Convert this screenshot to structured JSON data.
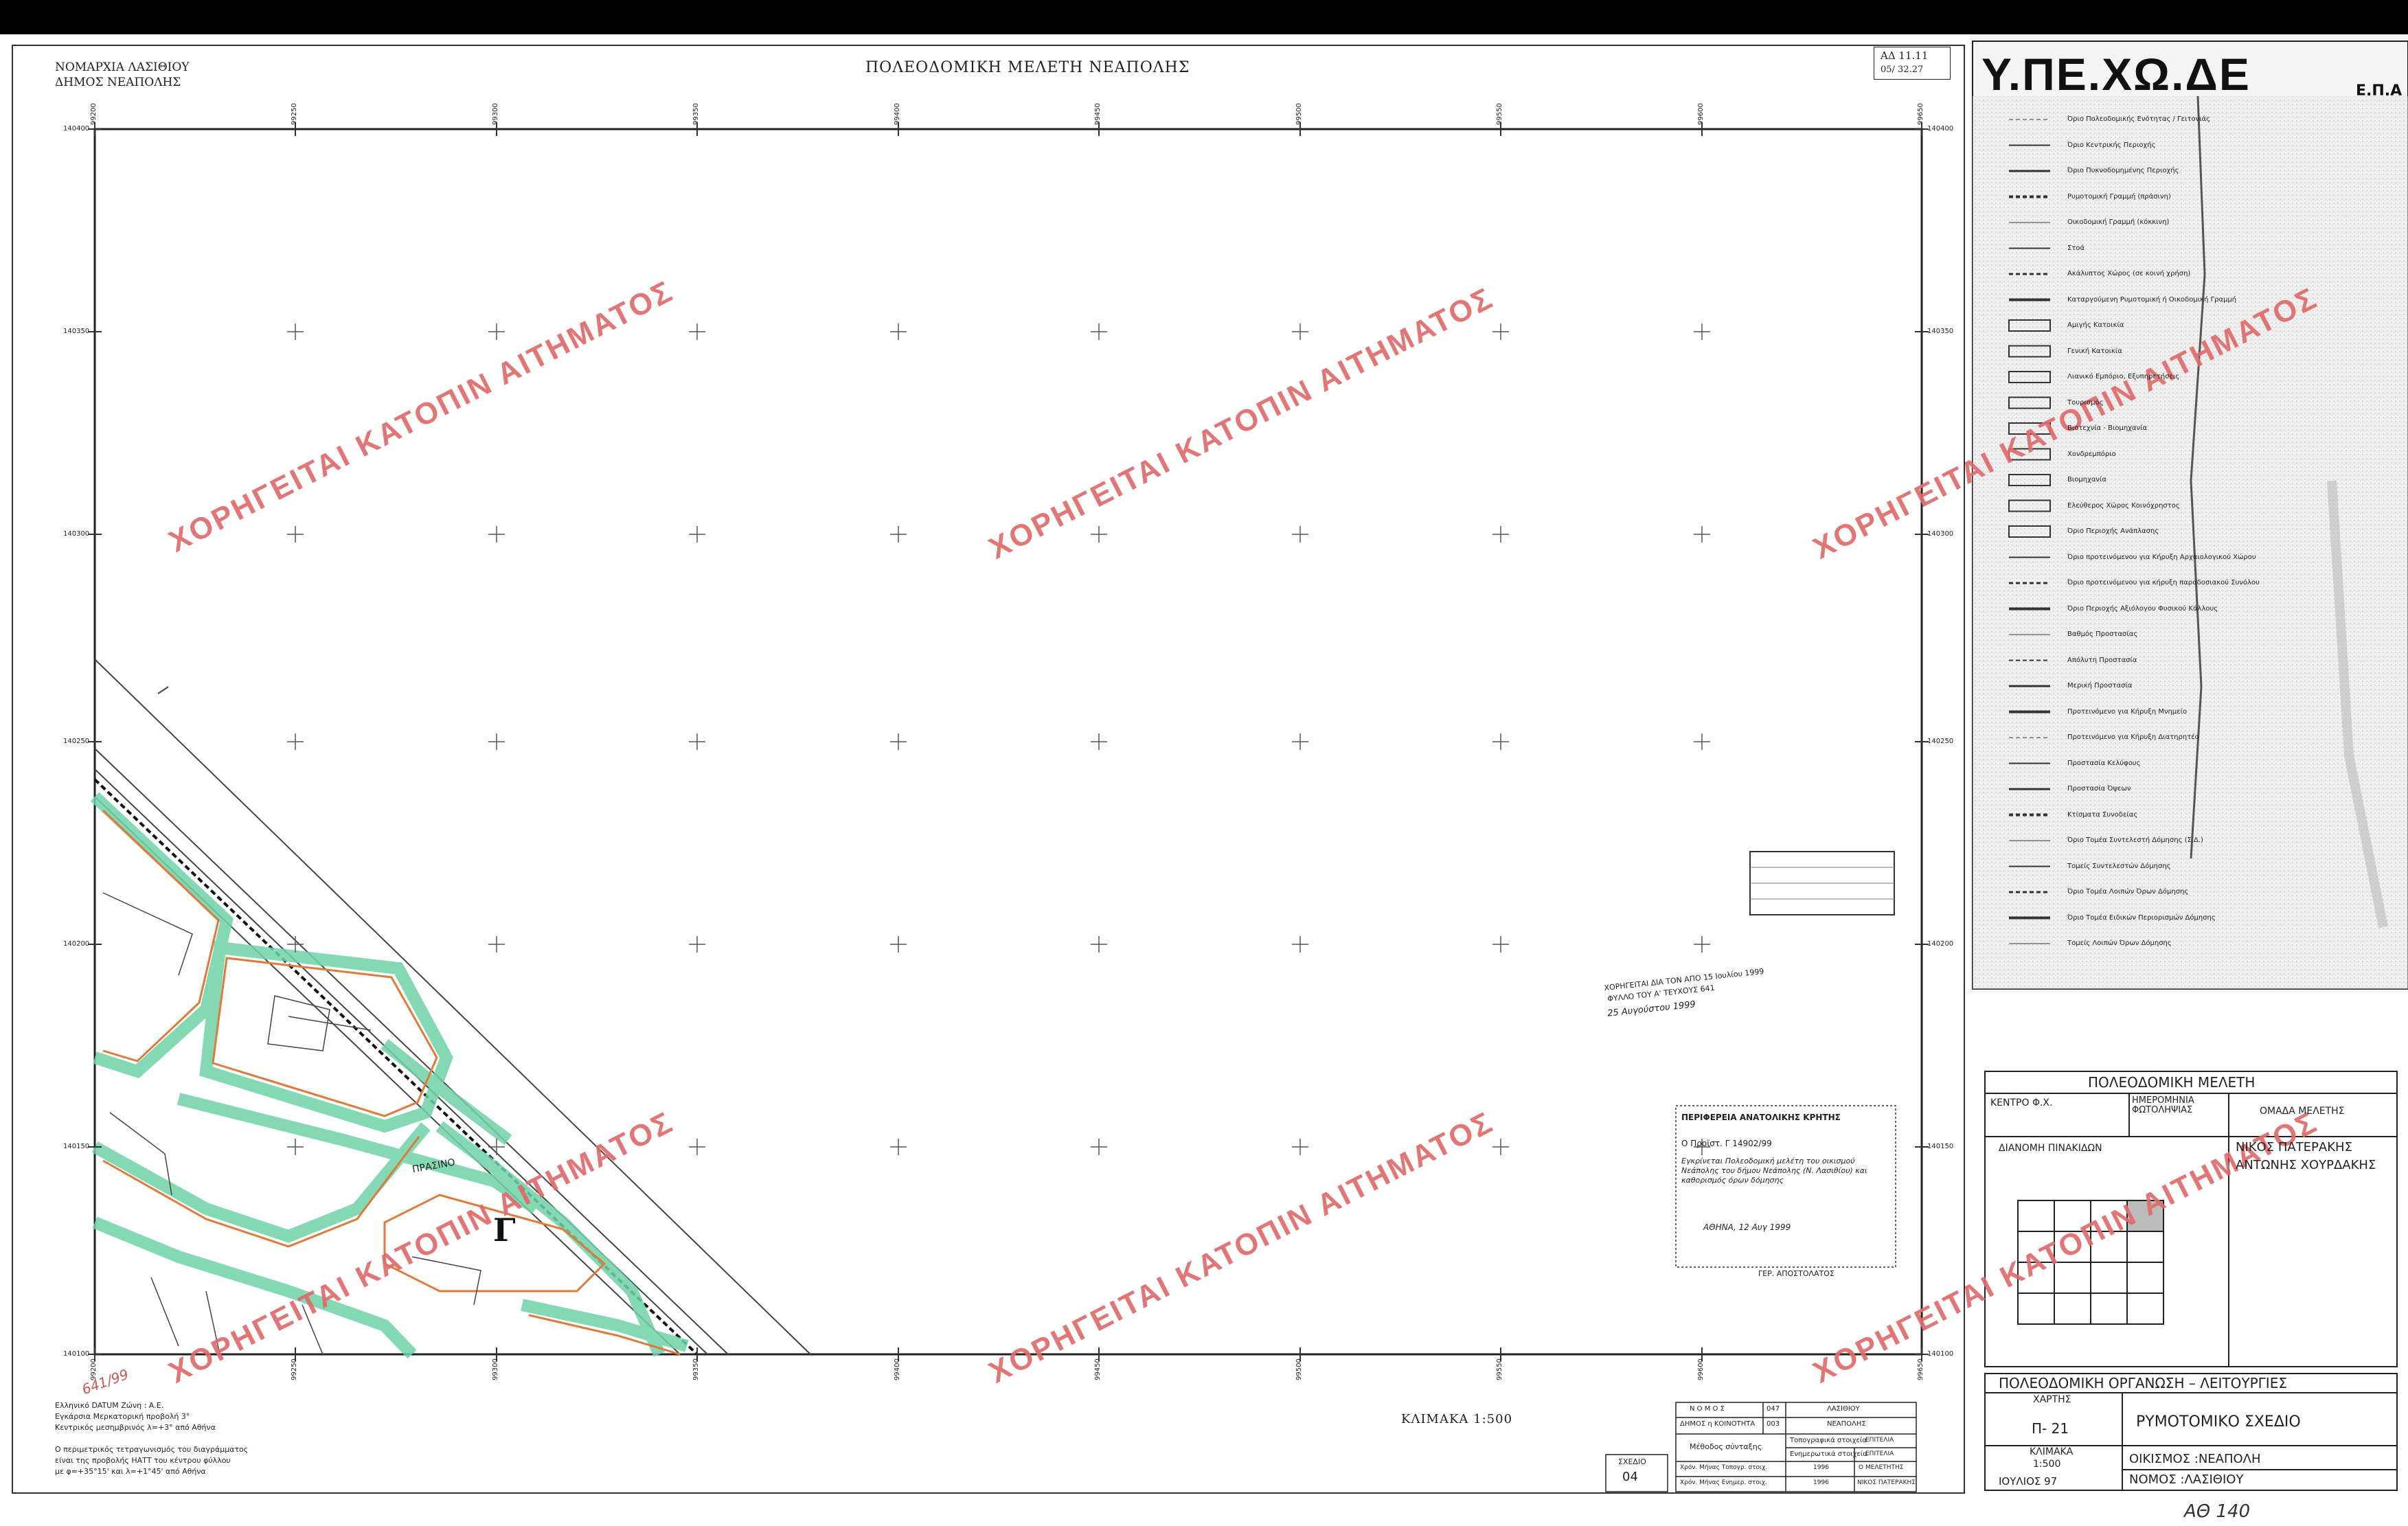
{
  "header": {
    "prefecture": "ΝΟΜΑΡΧΙΑ ΛΑΣΙΘΙΟΥ",
    "municipality": "ΔΗΜΟΣ      ΝΕΑΠΟΛΗΣ",
    "title": "ΠΟΛΕΟΔΟΜΙΚΗ ΜΕΛΕΤΗ ΝΕΑΠΟΛΗΣ",
    "sheet_ref_1": "ΑΔ   11.11",
    "sheet_ref_2": "05/   32.27"
  },
  "logo": {
    "text": "Υ.ΠΕ.ΧΩ.ΔΕ",
    "sub": "Ε.Π.Α"
  },
  "grid": {
    "x_labels": [
      "99200",
      "99250",
      "99300",
      "99350",
      "99400",
      "99450",
      "99500",
      "99550",
      "99600",
      "99650"
    ],
    "y_labels": [
      "140400",
      "140350",
      "140300",
      "140250",
      "140200",
      "140150",
      "140100"
    ]
  },
  "watermark": "ΧΟΡΗΓΕΙΤΑΙ ΚΑΤΟΠΙΝ ΑΙΤΗΜΑΤΟΣ",
  "map_labels": {
    "block": "Γ",
    "prasino": "ΠΡΑΣΙΝΟ",
    "handwritten": "641/99"
  },
  "legend": [
    "Όριο Πολεοδομικής Ενότητας / Γειτονιάς",
    "Όριο Κεντρικής Περιοχής",
    "Όριο Πυκνοδομημένης Περιοχής",
    "Ρυμοτομική Γραμμή (πράσινη)",
    "Οικοδομική Γραμμή (κόκκινη)",
    "Στοά",
    "Ακάλυπτος Χώρος (σε κοινή χρήση)",
    "Καταργούμενη Ρυμοτομική ή Οικοδομική Γραμμή",
    "Αμιγής Κατοικία",
    "Γενική Κατοικία",
    "Λιανικό Εμπόριο, Εξυπηρετήσεις",
    "Τουρισμός",
    "Βιοτεχνία - Βιομηχανία",
    "Χονδρεμπόριο",
    "Βιομηχανία",
    "Ελεύθερος Χώρος Κοινόχρηστος",
    "Όριο Περιοχής Ανάπλασης",
    "Όριο προτεινόμενου για Κήρυξη Αρχαιολογικού Χώρου",
    "Όριο προτεινόμενου για κήρυξη παραδοσιακού Συνόλου",
    "Όριο Περιοχής Αξιόλογου Φυσικού Κάλλους",
    "Βαθμός Προστασίας",
    "Απόλυτη Προστασία",
    "Μερική Προστασία",
    "Προτεινόμενο για Κήρυξη Μνημείο",
    "Προτεινόμενο για Κήρυξη Διατηρητέο",
    "Προστασία Κελύφους",
    "Προστασία Όψεων",
    "Κτίσματα Συνοδείας",
    "Όριο Τομέα Συντελεστή Δόμησης (Σ.Δ.)",
    "Τομείς Συντελεστών Δόμησης",
    "Όριο Τομέα Λοιπών Όρων Δόμησης",
    "Όριο Τομέα Ειδικών Περιορισμών Δόμησης",
    "Τομείς Λοιπών Όρων Δόμησης"
  ],
  "stamps": {
    "top": "ΧΟΡΗΓΕΙΤΑΙ ΔΙΑ ΤΟΝ ΑΠΟ 15 Ιουλίου 1999",
    "top2": "ΦΥΛΛΟ ΤΟΥ Α' ΤΕΥΧΟΥΣ 641",
    "top3": "25 Αυγούστου 1999",
    "mid1": "ΠΕΡΙΦΕΡΕΙΑ ΑΝΑΤΟΛΙΚΗΣ ΚΡΗΤΗΣ",
    "mid2": "Ο Προϊστ. Γ 14902/99",
    "mid3": "Εγκρίνεται Πολεοδομική μελέτη του οικισμού Νεάπολης του δήμου Νεάπολης (Ν. Λασιθίου) και καθορισμός όρων δόμησης",
    "mid4": "ΑΘΗΝΑ, 12 Αυγ 1999",
    "sign": "ΓΕΡ. ΑΠΟΣΤΟΛΑΤΟΣ"
  },
  "title_block": {
    "study": "ΠΟΛΕΟΔΟΜΙΚΗ        ΜΕΛΕΤΗ",
    "center": "ΚΕΝΤΡΟ  Φ.Χ.",
    "photo_date": "ΗΜΕΡΟΜΗΝΙΑ ΦΩΤΟΛΗΨΙΑΣ",
    "team": "ΟΜΑΔΑ     ΜΕΛΕΤΗΣ",
    "distribution": "ΔΙΑΝΟΜΗ ΠΙΝΑΚΙΔΩΝ",
    "member1": "ΝΙΚΟΣ ΠΑΤΕΡΑΚΗΣ",
    "member2": "ΑΝΤΩΝΗΣ ΧΟΥΡΔΑΚΗΣ",
    "org": "ΠΟΛΕΟΔΟΜΙΚΗ ΟΡΓΑΝΩΣΗ – ΛΕΙΤΟΥΡΓΙΕΣ",
    "map_label": "ΧΑΡΤΗΣ",
    "map_no": "Π- 21",
    "map_name": "ΡΥΜΟΤΟΜΙΚΟ        ΣΧΕΔΙΟ",
    "scale_label": "ΚΛΙΜΑΚΑ",
    "scale": "1:500",
    "settlement": "ΟΙΚΙΣΜΟΣ :ΝΕΑΠΟΛΗ",
    "date": "ΙΟΥΛΙΟΣ  97",
    "nomos": "ΝΟΜΟΣ :ΛΑΣΙΘΙΟΥ"
  },
  "footer": {
    "datum1": "Ελληνικό DATUM   Ζώνη : Α.Ε.",
    "datum2": "Εγκάρσια Μερκατορική προβολή 3°",
    "datum3": "Κεντρικός μεσημβρινός λ=+3° από Αθήνα",
    "datum4": "Ο περιμετρικός τετραγωνισμός του διαγράμματος",
    "datum5": "είναι της προβολής ΗΑΤΤ του κέντρου φύλλου",
    "datum6": "με φ=+35°15'  και  λ=+1°45'  από Αθήνα",
    "scale": "ΚΛΙΜΑΚΑ  1:500",
    "sheet_label": "ΣΧΕΔΙΟ",
    "sheet_no": "04",
    "nomos": "Ν Ο Μ Ο Σ",
    "nomos_code": "047",
    "nomos_val": "ΛΑΣΙΘΙΟΥ",
    "dimos": "ΔΗΜΟΣ η ΚΟΙΝΟΤΗΤΑ",
    "dimos_code": "003",
    "dimos_val": "ΝΕΑΠΟΛΗΣ",
    "method": "Μέθοδος σύνταξης",
    "topo": "Τοπογραφικά στοιχεία",
    "topo_v": "ΕΠΙΤΕΛΙΑ",
    "upd": "Ενημερωτικά στοιχεία",
    "upd_v": "ΕΠΙΤΕΛΙΑ",
    "row1": "Χρόν. Μήνας Τοπογρ. στοιχ.",
    "row1_y": "1996",
    "row1_n": "Ο ΜΕΛΕΤΗΤΗΣ",
    "row2": "Χρόν. Μήνας Ενημερ. στοιχ.",
    "row2_y": "1996",
    "row2_n": "ΝΙΚΟΣ ΠΑΤΕΡΑΚΗΣ"
  },
  "corner_handwritten": "ΑΘ 140"
}
